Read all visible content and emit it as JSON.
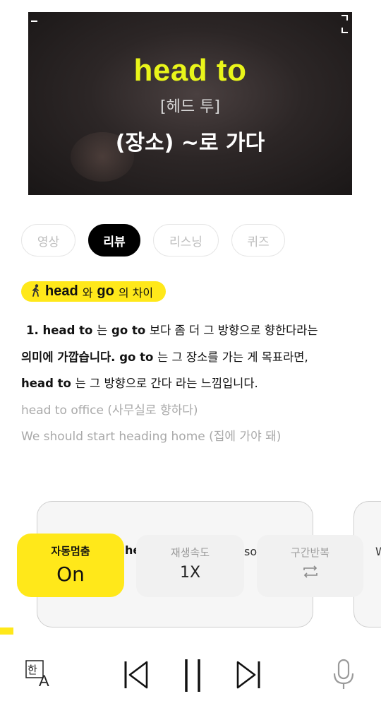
{
  "video": {
    "word": "head to",
    "pronunciation": "[헤드 투]",
    "meaning": "(장소) ~로 가다"
  },
  "tabs": [
    {
      "label": "영상",
      "active": false
    },
    {
      "label": "리뷰",
      "active": true
    },
    {
      "label": "리스닝",
      "active": false
    },
    {
      "label": "퀴즈",
      "active": false
    }
  ],
  "tag": {
    "word1": "head",
    "connector": "와",
    "word2": "go",
    "suffix": "의 차이"
  },
  "explanation": {
    "l1_num": "1.",
    "l1_w1": "head to",
    "l1_t1": "는",
    "l1_w2": "go to",
    "l1_t2": "보다 좀 더 그 방향으로 향한다라는",
    "l2_t1": "의미에 가깝습니다.",
    "l2_w1": "go to",
    "l2_t2": "는 그 장소를 가는 게 목표라면,",
    "l3_w1": "head to",
    "l3_t1": "는 그 방향으로 간다 라는 느낌입니다."
  },
  "examples": [
    "head to office (사무실로 향하다)",
    "We should start heading home (집에 가야 돼)"
  ],
  "card_peek": {
    "left": "he",
    "right": "so",
    "edge": "W"
  },
  "controls": {
    "auto_pause_label": "자동멈춤",
    "auto_pause_value": "On",
    "speed_label": "재생속도",
    "speed_value": "1X",
    "repeat_label": "구간반복"
  },
  "colors": {
    "accent": "#ffe81a",
    "video_text": "#e9f51a"
  },
  "icons": [
    "fullscreen-icon",
    "walking-person-icon",
    "repeat-icon",
    "translate-icon",
    "previous-icon",
    "pause-icon",
    "next-icon",
    "microphone-icon"
  ]
}
